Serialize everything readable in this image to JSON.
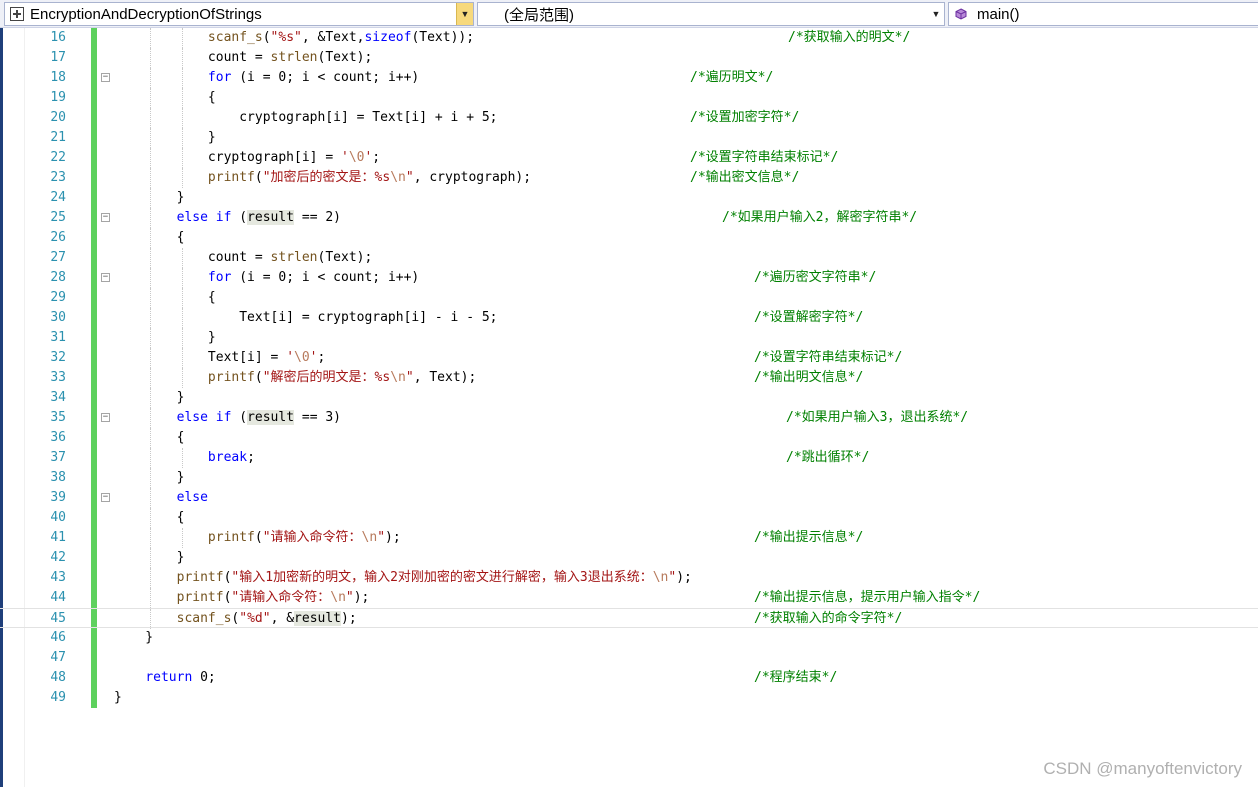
{
  "navigation": {
    "file_combo": "EncryptionAndDecryptionOfStrings",
    "scope_combo": "(全局范围)",
    "member_combo": "main()"
  },
  "code_lines": [
    {
      "n": "16",
      "code": "            scanf_s(\"%s\", &Text,sizeof(Text));",
      "comment": "/*获取输入的明文*/"
    },
    {
      "n": "17",
      "code": "            count = strlen(Text);",
      "comment": ""
    },
    {
      "n": "18",
      "code": "            for (i = 0; i < count; i++)",
      "comment": "/*遍历明文*/"
    },
    {
      "n": "19",
      "code": "            {",
      "comment": ""
    },
    {
      "n": "20",
      "code": "                cryptograph[i] = Text[i] + i + 5;",
      "comment": "/*设置加密字符*/"
    },
    {
      "n": "21",
      "code": "            }",
      "comment": ""
    },
    {
      "n": "22",
      "code": "            cryptograph[i] = '\\0';",
      "comment": "/*设置字符串结束标记*/"
    },
    {
      "n": "23",
      "code": "            printf(\"加密后的密文是：%s\\n\", cryptograph);",
      "comment": "/*输出密文信息*/"
    },
    {
      "n": "24",
      "code": "        }",
      "comment": ""
    },
    {
      "n": "25",
      "code": "        else if (result == 2)",
      "comment": "/*如果用户输入2，解密字符串*/"
    },
    {
      "n": "26",
      "code": "        {",
      "comment": ""
    },
    {
      "n": "27",
      "code": "            count = strlen(Text);",
      "comment": ""
    },
    {
      "n": "28",
      "code": "            for (i = 0; i < count; i++)",
      "comment": "/*遍历密文字符串*/"
    },
    {
      "n": "29",
      "code": "            {",
      "comment": ""
    },
    {
      "n": "30",
      "code": "                Text[i] = cryptograph[i] - i - 5;",
      "comment": "/*设置解密字符*/"
    },
    {
      "n": "31",
      "code": "            }",
      "comment": ""
    },
    {
      "n": "32",
      "code": "            Text[i] = '\\0';",
      "comment": "/*设置字符串结束标记*/"
    },
    {
      "n": "33",
      "code": "            printf(\"解密后的明文是：%s\\n\", Text);",
      "comment": "/*输出明文信息*/"
    },
    {
      "n": "34",
      "code": "        }",
      "comment": ""
    },
    {
      "n": "35",
      "code": "        else if (result == 3)",
      "comment": "/*如果用户输入3，退出系统*/"
    },
    {
      "n": "36",
      "code": "        {",
      "comment": ""
    },
    {
      "n": "37",
      "code": "            break;",
      "comment": "/*跳出循环*/"
    },
    {
      "n": "38",
      "code": "        }",
      "comment": ""
    },
    {
      "n": "39",
      "code": "        else",
      "comment": ""
    },
    {
      "n": "40",
      "code": "        {",
      "comment": ""
    },
    {
      "n": "41",
      "code": "            printf(\"请输入命令符：\\n\");",
      "comment": "/*输出提示信息*/"
    },
    {
      "n": "42",
      "code": "        }",
      "comment": ""
    },
    {
      "n": "43",
      "code": "        printf(\"输入1加密新的明文，输入2对刚加密的密文进行解密，输入3退出系统：\\n\");",
      "comment": ""
    },
    {
      "n": "44",
      "code": "        printf(\"请输入命令符：\\n\");",
      "comment": "/*输出提示信息，提示用户输入指令*/"
    },
    {
      "n": "45",
      "code": "        scanf_s(\"%d\", &result);",
      "comment": "/*获取输入的命令字符*/"
    },
    {
      "n": "46",
      "code": "    }",
      "comment": ""
    },
    {
      "n": "47",
      "code": "",
      "comment": ""
    },
    {
      "n": "48",
      "code": "    return 0;",
      "comment": "/*程序结束*/"
    },
    {
      "n": "49",
      "code": "}",
      "comment": ""
    }
  ],
  "watermark": "CSDN @manyoftenvictory",
  "colors": {
    "keyword": "#0000ff",
    "string": "#a31515",
    "comment": "#008000",
    "line_number": "#2b91af",
    "change_bar": "#5dd15d"
  }
}
